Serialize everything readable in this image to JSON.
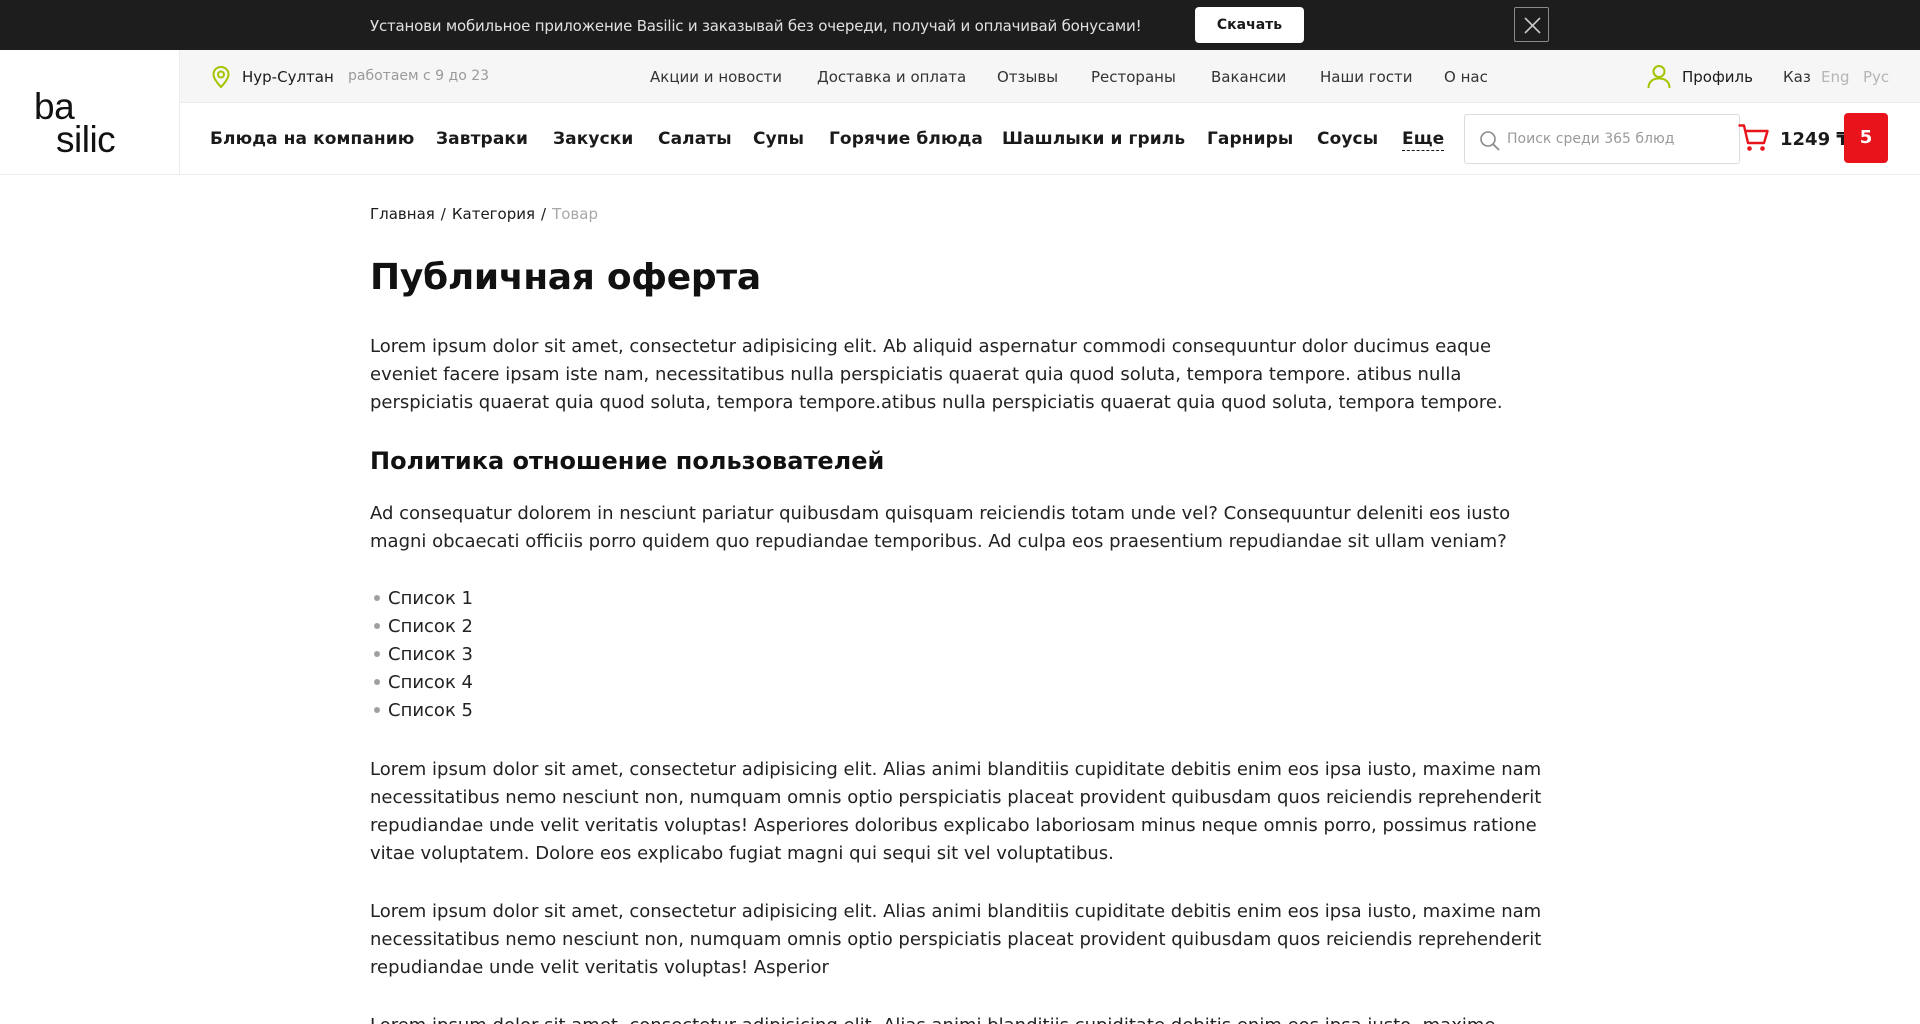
{
  "promo": {
    "text": "Установи мобильное приложение Basilic и заказывай без очереди, получай и оплачивай бонусами!",
    "button": "Скачать"
  },
  "logo": {
    "line1": "ba",
    "line2": "silic"
  },
  "topbar": {
    "city": "Нур-Султан",
    "hours": "работаем с 9 до 23",
    "links": [
      "Акции и новости",
      "Доставка и оплата",
      "Отзывы",
      "Рестораны",
      "Вакансии",
      "Наши гости",
      "О нас"
    ],
    "profile": "Профиль",
    "languages": [
      {
        "label": "Каз",
        "active": true
      },
      {
        "label": "Eng",
        "active": false
      },
      {
        "label": "Рус",
        "active": false
      }
    ]
  },
  "categories": [
    "Блюда на компанию",
    "Завтраки",
    "Закуски",
    "Салаты",
    "Супы",
    "Горячие блюда",
    "Шашлыки и гриль",
    "Гарниры",
    "Соусы",
    "Еще"
  ],
  "search": {
    "placeholder": "Поиск среди 365 блюд"
  },
  "cart": {
    "total": "1249 ₸",
    "count": "5"
  },
  "breadcrumb": [
    "Главная",
    "Категория",
    "Товар"
  ],
  "page": {
    "title": "Публичная оферта",
    "intro": "Lorem ipsum dolor sit amet, consectetur adipisicing elit. Ab aliquid aspernatur commodi consequuntur dolor ducimus eaque eveniet facere ipsam iste nam, necessitatibus nulla perspiciatis quaerat quia quod soluta, tempora tempore. atibus nulla perspiciatis quaerat quia quod soluta, tempora tempore.atibus nulla perspiciatis quaerat quia quod soluta, tempora tempore.",
    "section_title": "Политика отношение пользователей",
    "section_text": "Ad consequatur dolorem in nesciunt pariatur quibusdam quisquam reiciendis totam unde vel? Consequuntur deleniti eos iusto magni obcaecati officiis porro quidem quo repudiandae temporibus. Ad culpa eos praesentium repudiandae sit ullam veniam?",
    "list": [
      "Список 1",
      "Список 2",
      "Список 3",
      "Список 4",
      "Список 5"
    ],
    "para2": "Lorem ipsum dolor sit amet, consectetur adipisicing elit. Alias animi blanditiis cupiditate debitis enim eos ipsa iusto, maxime nam necessitatibus nemo nesciunt non, numquam omnis optio perspiciatis placeat provident quibusdam quos reiciendis reprehenderit repudiandae unde velit veritatis voluptas! Asperiores doloribus explicabo laboriosam minus neque omnis porro, possimus ratione vitae voluptatem. Dolore eos explicabo fugiat magni qui sequi sit vel voluptatibus.",
    "para3": "Lorem ipsum dolor sit amet, consectetur adipisicing elit. Alias animi blanditiis cupiditate debitis enim eos ipsa iusto, maxime nam necessitatibus nemo nesciunt non, numquam omnis optio perspiciatis placeat provident quibusdam quos reiciendis reprehenderit repudiandae unde velit veritatis voluptas! Asperior",
    "para4": "Lorem ipsum dolor sit amet, consectetur adipisicing elit. Alias animi blanditiis cupiditate debitis enim eos ipsa iusto, maxime"
  },
  "colors": {
    "accent": "#e8131b",
    "icon_green": "#a5c400",
    "promo_bg": "#1d1d1d"
  },
  "icons": [
    "location-pin-icon",
    "user-icon",
    "search-icon",
    "cart-icon",
    "close-icon"
  ]
}
